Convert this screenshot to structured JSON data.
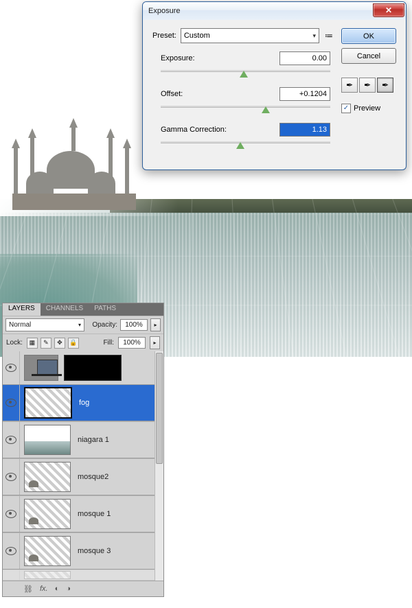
{
  "dialog": {
    "title": "Exposure",
    "preset_label": "Preset:",
    "preset_value": "Custom",
    "ok": "OK",
    "cancel": "Cancel",
    "preview_label": "Preview",
    "preview_checked": true,
    "params": [
      {
        "label": "Exposure:",
        "value": "0.00",
        "thumb_pct": 49
      },
      {
        "label": "Offset:",
        "value": "+0.1204",
        "thumb_pct": 62
      },
      {
        "label": "Gamma Correction:",
        "value": "1.13",
        "thumb_pct": 47,
        "selected": true
      }
    ]
  },
  "layers_panel": {
    "tabs": [
      "LAYERS",
      "CHANNELS",
      "PATHS"
    ],
    "active_tab": 0,
    "blend_mode": "Normal",
    "opacity_label": "Opacity:",
    "opacity_value": "100%",
    "fill_label": "Fill:",
    "fill_value": "100%",
    "lock_label": "Lock:",
    "layers": [
      {
        "name": "fog",
        "visible": true,
        "selected": true,
        "thumb": "checker"
      },
      {
        "name": "niagara 1",
        "visible": true,
        "selected": false,
        "thumb": "niag"
      },
      {
        "name": "mosque2",
        "visible": true,
        "selected": false,
        "thumb": "checker"
      },
      {
        "name": "mosque 1",
        "visible": true,
        "selected": false,
        "thumb": "checker"
      },
      {
        "name": "mosque 3",
        "visible": true,
        "selected": false,
        "thumb": "checker"
      }
    ]
  }
}
